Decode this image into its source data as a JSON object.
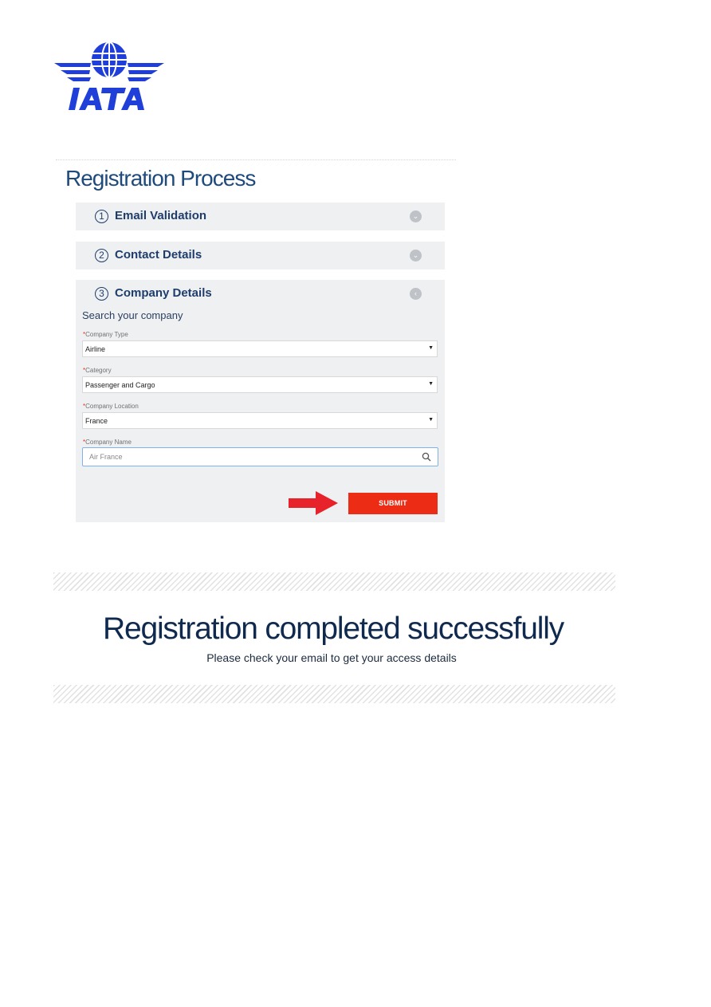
{
  "brand": {
    "logo_text": "IATA",
    "logo_color": "#1f3fd8"
  },
  "registration": {
    "title": "Registration Process",
    "steps": [
      {
        "number": "1",
        "label": "Email Validation",
        "state": "collapsed",
        "icon": "chevron-down-icon"
      },
      {
        "number": "2",
        "label": "Contact Details",
        "state": "collapsed",
        "icon": "chevron-down-icon"
      },
      {
        "number": "3",
        "label": "Company Details",
        "state": "expanded",
        "icon": "chevron-left-icon"
      }
    ],
    "company": {
      "heading": "Search your company",
      "required_mark": "*",
      "fields": [
        {
          "label": "Company Type",
          "value": "Airline"
        },
        {
          "label": "Category",
          "value": "Passenger and Cargo"
        },
        {
          "label": "Company Location",
          "value": "France"
        }
      ],
      "name_field": {
        "label": "Company Name",
        "value": "Air France",
        "icon": "search-icon"
      },
      "submit_label": "SUBMIT",
      "submit_color": "#ed2c16",
      "pointer": "arrow-right-icon"
    }
  },
  "result": {
    "title": "Registration completed successfully",
    "subtitle": "Please check your email to get your access details"
  },
  "colors": {
    "accent": "#1f3d6b",
    "panel_bg": "#eff0f2",
    "arrow": "#e8222a"
  }
}
